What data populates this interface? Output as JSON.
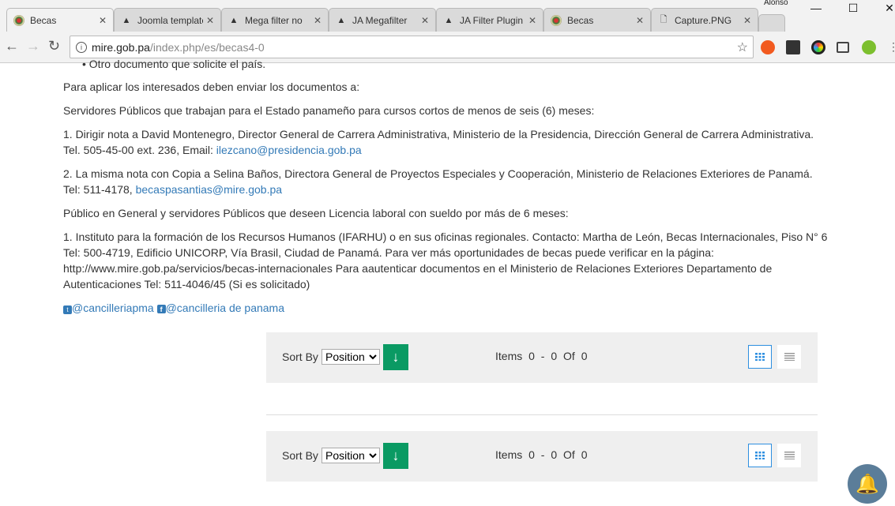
{
  "browser": {
    "tabs": [
      {
        "label": "Becas",
        "icon": "seal-icon",
        "active": true
      },
      {
        "label": "Joomla template",
        "icon": "joomlart-icon"
      },
      {
        "label": "Mega filter no",
        "icon": "joomlart-icon"
      },
      {
        "label": "JA Megafilter",
        "icon": "joomlart-icon"
      },
      {
        "label": "JA Filter Plugin",
        "icon": "joomlart-icon"
      },
      {
        "label": "Becas",
        "icon": "seal-icon"
      },
      {
        "label": "Capture.PNG",
        "icon": "file-icon"
      }
    ],
    "user": "Alonso",
    "url_host": "mire.gob.pa",
    "url_path": "/index.php/es/becas4-0"
  },
  "content": {
    "bullet": "Otro documento que solicite el país.",
    "p1": "Para aplicar los interesados deben enviar los documentos a:",
    "p2": "Servidores Públicos que trabajan para el Estado panameño para cursos cortos de menos de seis (6) meses:",
    "p3a": "1. Dirigir nota a David Montenegro, Director General de Carrera Administrativa, Ministerio de la Presidencia, Dirección General de Carrera Administrativa.",
    "p3b": "Tel. 505-45-00 ext. 236, Email: ",
    "p3_link": "ilezcano@presidencia.gob.pa",
    "p4a": "2. La misma nota con Copia a Selina Baños, Directora General de Proyectos Especiales y Cooperación, Ministerio de Relaciones Exteriores de Panamá.",
    "p4b": "Tel: 511-4178, ",
    "p4_link": "becaspasantias@mire.gob.pa",
    "p5": "Público en General y servidores Públicos que deseen Licencia laboral con sueldo por más de 6 meses:",
    "p6a": "1. Instituto para la formación de los Recursos Humanos (IFARHU) o en sus oficinas regionales. Contacto: Martha de León, Becas Internacionales, Piso N° 6",
    "p6b": "Tel: 500-4719, Edificio UNICORP, Vía Brasil, Ciudad de Panamá. Para ver más oportunidades de becas puede verificar en la página:",
    "p6c": "http://www.mire.gob.pa/servicios/becas-internacionales Para aautenticar documentos en el Ministerio de Relaciones Exteriores Departamento de",
    "p6d": "Autenticaciones Tel: 511-4046/45 (Si es solicitado)",
    "twitter": "@cancilleriapma",
    "facebook": "@cancilleria de panama"
  },
  "toolbar": {
    "sort_label": "Sort By",
    "sort_value": "Position",
    "items_label": "Items",
    "items_range": "0 - 0",
    "of_label": "Of",
    "total": "0"
  }
}
